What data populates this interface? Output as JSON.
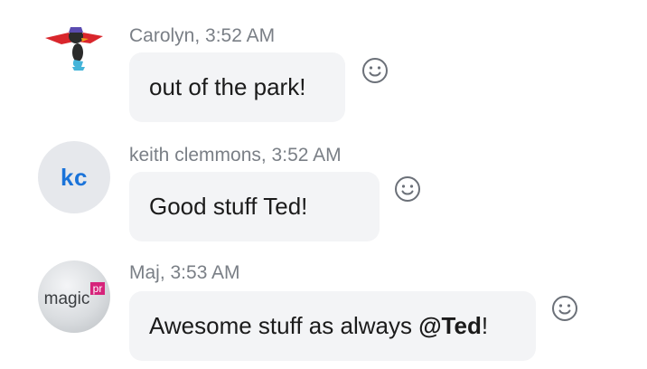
{
  "messages": [
    {
      "author": "Carolyn",
      "time": "3:52 AM",
      "header": "Carolyn, 3:52 AM",
      "text": "out of the park!",
      "avatar_icon": "superhero-duck-avatar"
    },
    {
      "author": "keith clemmons",
      "time": "3:52 AM",
      "header": "keith clemmons, 3:52 AM",
      "text": "Good stuff Ted!",
      "avatar_initials": "kc"
    },
    {
      "author": "Maj",
      "time": "3:53 AM",
      "header": "Maj, 3:53 AM",
      "text_before": "Awesome stuff as always ",
      "mention": "@Ted",
      "text_after": "!",
      "avatar_logo_text": "magic",
      "avatar_logo_badge": "pr"
    }
  ],
  "icons": {
    "reaction": "smiley-face-icon"
  },
  "colors": {
    "bubble": "#f3f4f6",
    "meta_text": "#7a7f86",
    "initials": "#1a73d9",
    "logo_badge": "#d6237a"
  }
}
